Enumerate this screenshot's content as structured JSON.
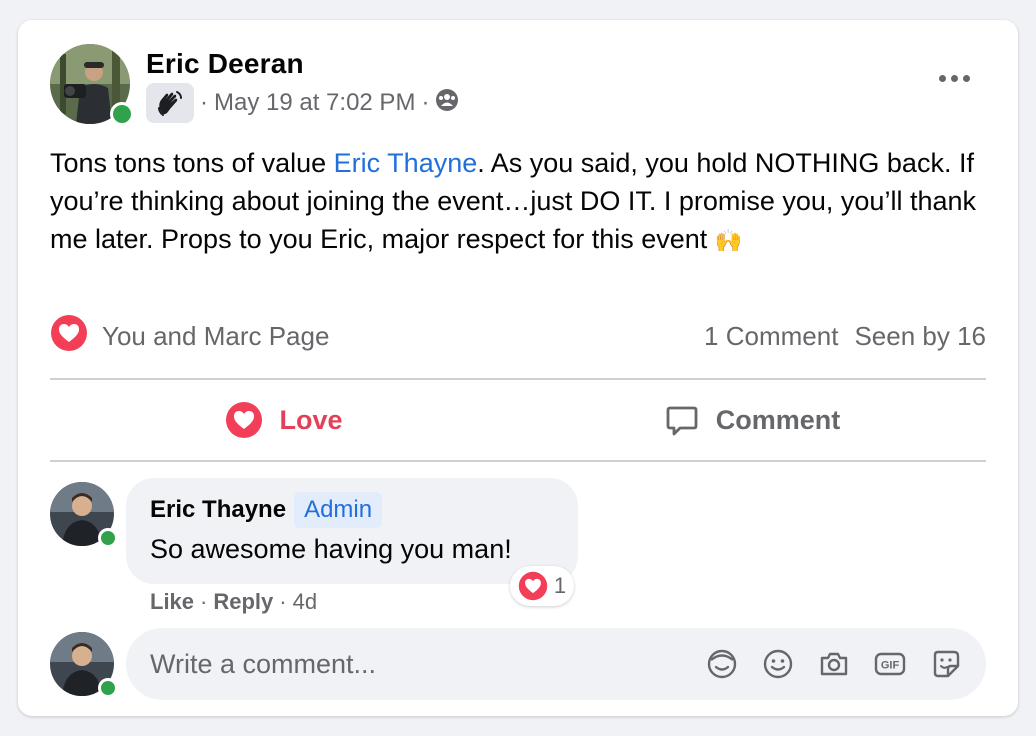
{
  "post": {
    "author": "Eric Deeran",
    "timestamp": "May 19 at 7:02 PM",
    "separator": "·",
    "audience_icon": "group-audience-icon",
    "badge_icon": "waving-hand-icon",
    "body_before": "Tons tons tons of value ",
    "mention": "Eric Thayne",
    "body_after": ". As you said, you hold NOTHING back. If you’re thinking about joining the event…just DO IT. I promise you, you’ll thank me later. Props to you Eric, major respect for this event ",
    "body_emoji": "🙌",
    "reactions_text": "You and Marc Page",
    "comment_count": "1 Comment",
    "seen_by": "Seen by 16"
  },
  "actions": {
    "love": "Love",
    "comment": "Comment"
  },
  "comment": {
    "author": "Eric Thayne",
    "badge": "Admin",
    "text": "So awesome having you man!",
    "reaction_count": "1",
    "like": "Like",
    "reply": "Reply",
    "sep": "·",
    "age": "4d"
  },
  "composer": {
    "placeholder": "Write a comment..."
  },
  "colors": {
    "love": "#e4405a",
    "link": "#216fdb",
    "online": "#31a24c",
    "muted": "#65676b"
  }
}
